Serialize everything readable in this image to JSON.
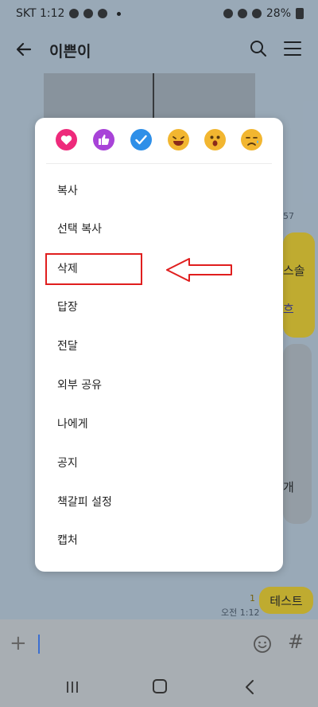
{
  "status": {
    "carrier_time": "SKT 1:12",
    "battery": "28%"
  },
  "header": {
    "title": "이쁜이"
  },
  "chat": {
    "time_57": "57",
    "partial_1": "스솔",
    "partial_2": "흐",
    "partial_3": "개",
    "test_message": "테스트",
    "unread": "1",
    "test_time": "오전 1:12"
  },
  "reactions": [
    {
      "name": "heart",
      "color": "#ee2a7b"
    },
    {
      "name": "thumbs-up",
      "color": "#a843d8"
    },
    {
      "name": "check",
      "color": "#2e8fe8"
    },
    {
      "name": "laugh",
      "color": "#f2b630"
    },
    {
      "name": "surprised",
      "color": "#f2b630"
    },
    {
      "name": "sad",
      "color": "#f2b630"
    }
  ],
  "menu": {
    "items": [
      "복사",
      "선택 복사",
      "삭제",
      "답장",
      "전달",
      "외부 공유",
      "나에게",
      "공지",
      "책갈피 설정",
      "캡처"
    ]
  },
  "annotation": {
    "highlight_color": "#e01e1e",
    "highlighted_item": "삭제"
  }
}
